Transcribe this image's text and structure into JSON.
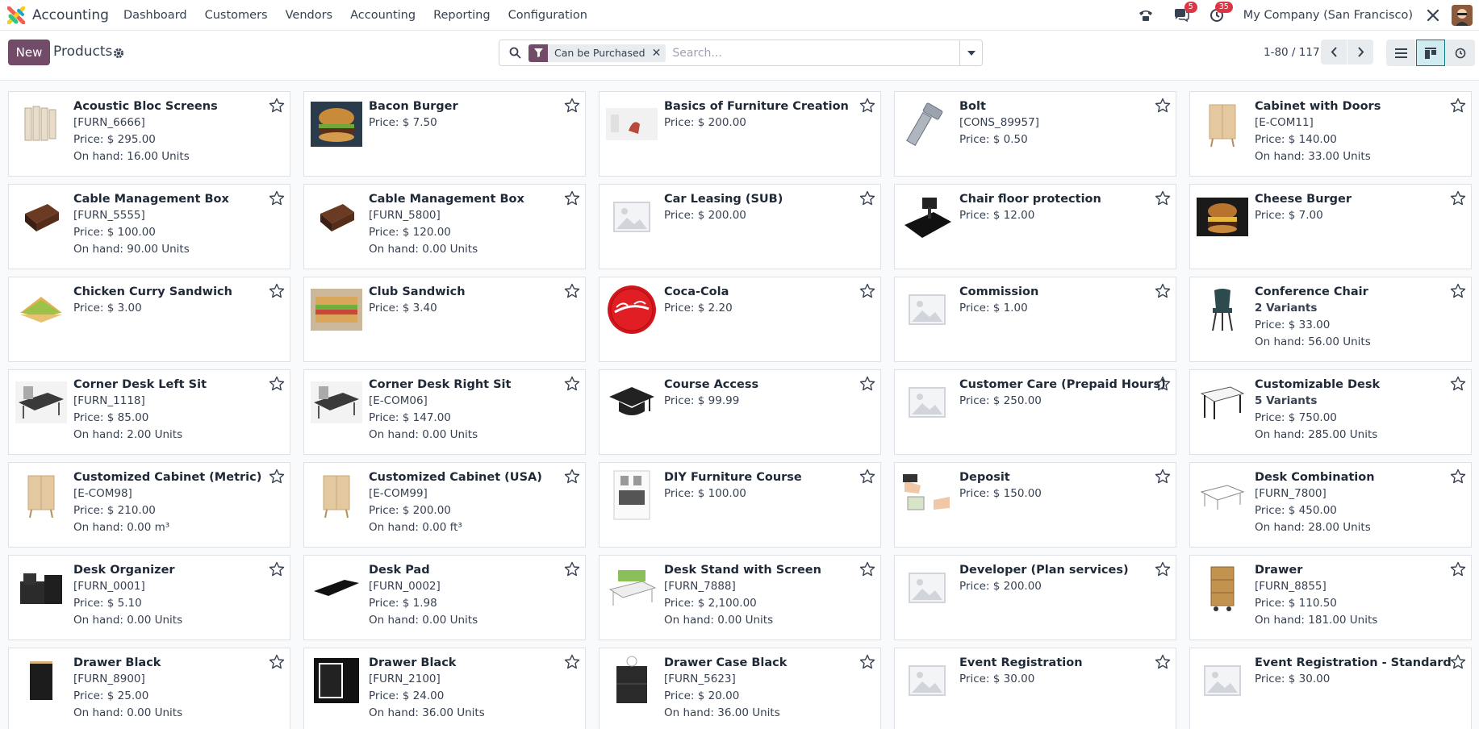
{
  "app": {
    "name": "Accounting"
  },
  "menu": [
    "Dashboard",
    "Customers",
    "Vendors",
    "Accounting",
    "Reporting",
    "Configuration"
  ],
  "systray": {
    "messages_count": "5",
    "activities_count": "35",
    "company": "My Company (San Francisco)"
  },
  "control": {
    "new_label": "New",
    "title": "Products",
    "facet_label": "Can be Purchased",
    "search_placeholder": "Search...",
    "pager": "1-80 / 117"
  },
  "products": [
    {
      "name": "Acoustic Bloc Screens",
      "ref": "[FURN_6666]",
      "price": "Price: $ 295.00",
      "onhand": "On hand: 16.00 Units",
      "image": "acoustic-screens"
    },
    {
      "name": "Bacon Burger",
      "price": "Price: $ 7.50",
      "image": "burger"
    },
    {
      "name": "Basics of Furniture Creation",
      "price": "Price: $ 200.00",
      "image": "furniture-course"
    },
    {
      "name": "Bolt",
      "ref": "[CONS_89957]",
      "price": "Price: $ 0.50",
      "image": "bolt"
    },
    {
      "name": "Cabinet with Doors",
      "ref": "[E-COM11]",
      "price": "Price: $ 140.00",
      "onhand": "On hand: 33.00 Units",
      "image": "cabinet"
    },
    {
      "name": "Cable Management Box",
      "ref": "[FURN_5555]",
      "price": "Price: $ 100.00",
      "onhand": "On hand: 90.00 Units",
      "image": "cable-box"
    },
    {
      "name": "Cable Management Box",
      "ref": "[FURN_5800]",
      "price": "Price: $ 120.00",
      "onhand": "On hand: 0.00 Units",
      "image": "cable-box"
    },
    {
      "name": "Car Leasing (SUB)",
      "price": "Price: $ 200.00",
      "image": "placeholder"
    },
    {
      "name": "Chair floor protection",
      "price": "Price: $ 12.00",
      "image": "floor-mat"
    },
    {
      "name": "Cheese Burger",
      "price": "Price: $ 7.00",
      "image": "burger-dark"
    },
    {
      "name": "Chicken Curry Sandwich",
      "price": "Price: $ 3.00",
      "image": "sandwich"
    },
    {
      "name": "Club Sandwich",
      "price": "Price: $ 3.40",
      "image": "club-sandwich"
    },
    {
      "name": "Coca-Cola",
      "price": "Price: $ 2.20",
      "image": "coca-cola"
    },
    {
      "name": "Commission",
      "price": "Price: $ 1.00",
      "image": "placeholder"
    },
    {
      "name": "Conference Chair",
      "variants": "2 Variants",
      "price": "Price: $ 33.00",
      "onhand": "On hand: 56.00 Units",
      "image": "chair"
    },
    {
      "name": "Corner Desk Left Sit",
      "ref": "[FURN_1118]",
      "price": "Price: $ 85.00",
      "onhand": "On hand: 2.00 Units",
      "image": "corner-desk"
    },
    {
      "name": "Corner Desk Right Sit",
      "ref": "[E-COM06]",
      "price": "Price: $ 147.00",
      "onhand": "On hand: 0.00 Units",
      "image": "corner-desk"
    },
    {
      "name": "Course Access",
      "price": "Price: $ 99.99",
      "image": "graduation-cap"
    },
    {
      "name": "Customer Care (Prepaid Hours)",
      "price": "Price: $ 250.00",
      "image": "placeholder"
    },
    {
      "name": "Customizable Desk",
      "variants": "5 Variants",
      "price": "Price: $ 750.00",
      "onhand": "On hand: 285.00 Units",
      "image": "desk"
    },
    {
      "name": "Customized Cabinet (Metric)",
      "ref": "[E-COM98]",
      "price": "Price: $ 210.00",
      "onhand": "On hand: 0.00 m³",
      "image": "cabinet"
    },
    {
      "name": "Customized Cabinet (USA)",
      "ref": "[E-COM99]",
      "price": "Price: $ 200.00",
      "onhand": "On hand: 0.00 ft³",
      "image": "cabinet"
    },
    {
      "name": "DIY Furniture Course",
      "price": "Price: $ 100.00",
      "image": "diy-book"
    },
    {
      "name": "Deposit",
      "price": "Price: $ 150.00",
      "image": "deposit"
    },
    {
      "name": "Desk Combination",
      "ref": "[FURN_7800]",
      "price": "Price: $ 450.00",
      "onhand": "On hand: 28.00 Units",
      "image": "desk-combo"
    },
    {
      "name": "Desk Organizer",
      "ref": "[FURN_0001]",
      "price": "Price: $ 5.10",
      "onhand": "On hand: 0.00 Units",
      "image": "organizer"
    },
    {
      "name": "Desk Pad",
      "ref": "[FURN_0002]",
      "price": "Price: $ 1.98",
      "onhand": "On hand: 0.00 Units",
      "image": "desk-pad"
    },
    {
      "name": "Desk Stand with Screen",
      "ref": "[FURN_7888]",
      "price": "Price: $ 2,100.00",
      "onhand": "On hand: 0.00 Units",
      "image": "desk-stand"
    },
    {
      "name": "Developer (Plan services)",
      "price": "Price: $ 200.00",
      "image": "placeholder"
    },
    {
      "name": "Drawer",
      "ref": "[FURN_8855]",
      "price": "Price: $ 110.50",
      "onhand": "On hand: 181.00 Units",
      "image": "drawer"
    },
    {
      "name": "Drawer Black",
      "ref": "[FURN_8900]",
      "price": "Price: $ 25.00",
      "onhand": "On hand: 0.00 Units",
      "image": "drawer-black"
    },
    {
      "name": "Drawer Black",
      "ref": "[FURN_2100]",
      "price": "Price: $ 24.00",
      "onhand": "On hand: 36.00 Units",
      "image": "drawer-black-large"
    },
    {
      "name": "Drawer Case Black",
      "ref": "[FURN_5623]",
      "price": "Price: $ 20.00",
      "onhand": "On hand: 36.00 Units",
      "image": "drawer-case"
    },
    {
      "name": "Event Registration",
      "price": "Price: $ 30.00",
      "image": "placeholder"
    },
    {
      "name": "Event Registration - Standard",
      "price": "Price: $ 30.00",
      "image": "placeholder"
    }
  ]
}
